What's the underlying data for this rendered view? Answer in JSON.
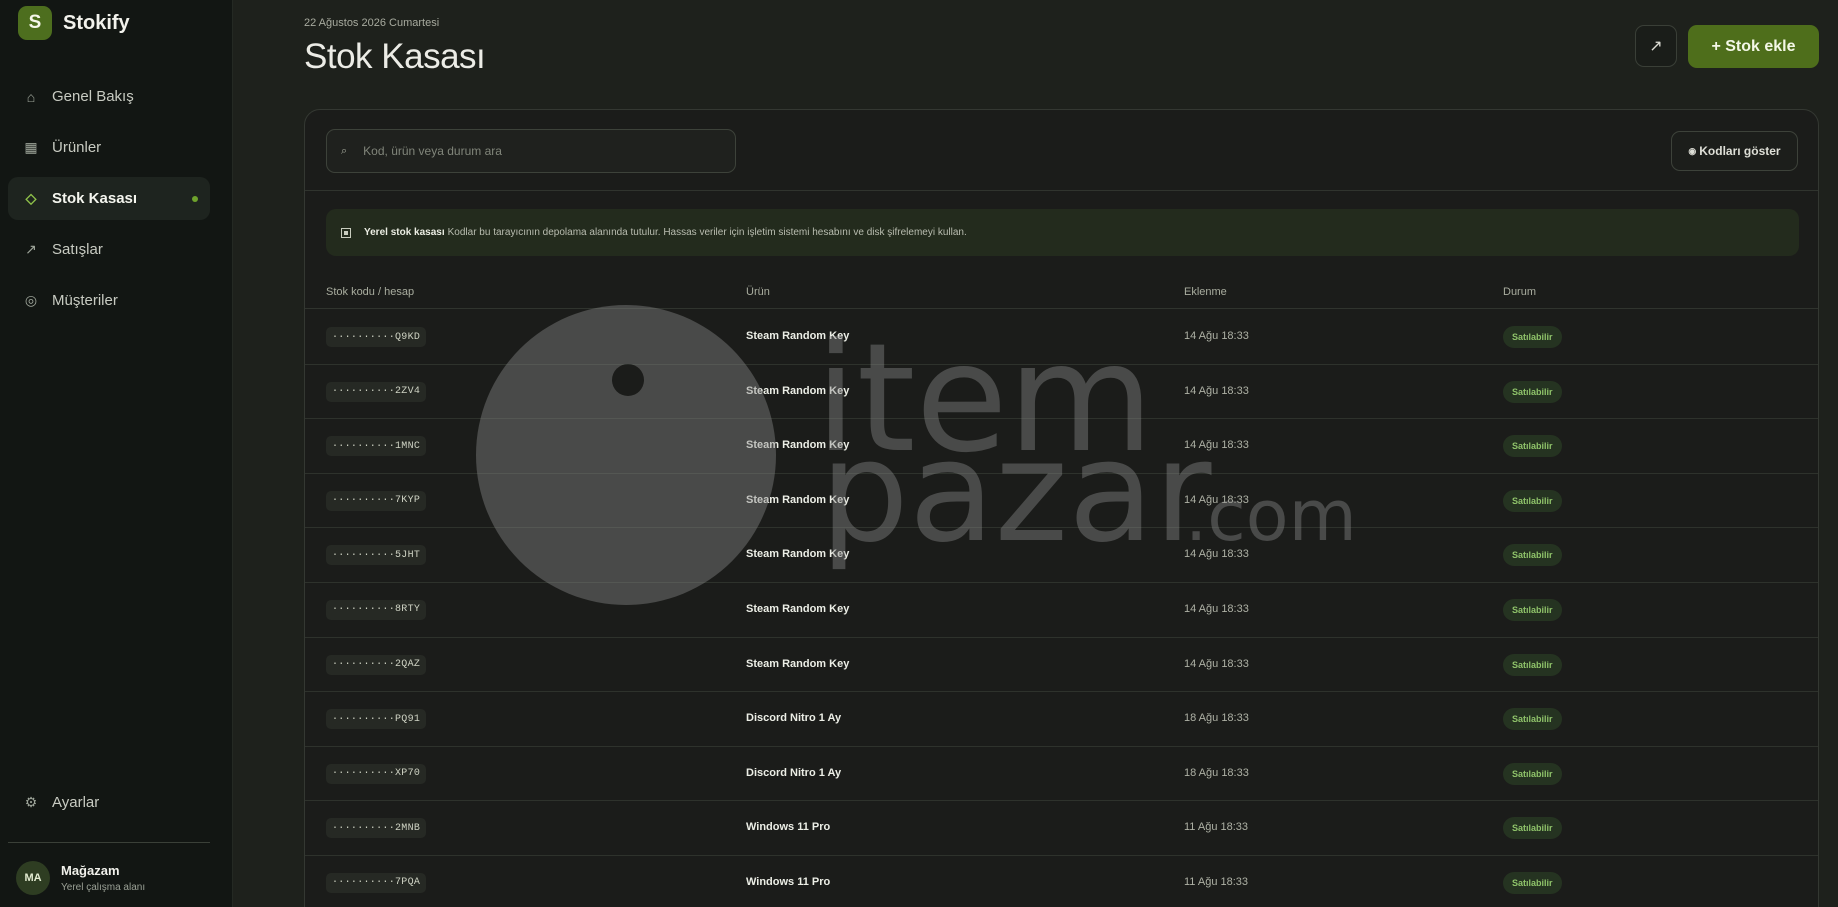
{
  "brand": {
    "logo_letter": "S",
    "name": "Stokify"
  },
  "nav": [
    {
      "label": "Genel Bakış",
      "icon": "home-icon",
      "glyph": "⌂",
      "active": false
    },
    {
      "label": "Ürünler",
      "icon": "grid-icon",
      "glyph": "▦",
      "active": false
    },
    {
      "label": "Stok Kasası",
      "icon": "diamond-icon",
      "glyph": "◇",
      "active": true
    },
    {
      "label": "Satışlar",
      "icon": "trend-arrow-icon",
      "glyph": "↗",
      "active": false
    },
    {
      "label": "Müşteriler",
      "icon": "target-icon",
      "glyph": "◎",
      "active": false
    }
  ],
  "settings": {
    "label": "Ayarlar",
    "glyph": "⚙"
  },
  "profile": {
    "initials": "MA",
    "name": "Mağazam",
    "subtitle": "Yerel çalışma alanı"
  },
  "header": {
    "date": "22 Ağustos 2026 Cumartesi",
    "title": "Stok Kasası",
    "export_glyph": "↗",
    "add_label": "+ Stok ekle"
  },
  "search": {
    "placeholder": "Kod, ürün veya durum ara",
    "icon_glyph": "⌕"
  },
  "show_codes": {
    "label": "Kodları göster",
    "icon_glyph": "◉"
  },
  "notice": {
    "title": "Yerel stok kasası",
    "text": "Kodlar bu tarayıcının depolama alanında tutulur. Hassas veriler için işletim sistemi hesabını ve disk şifrelemeyi kullan."
  },
  "table": {
    "columns": [
      "Stok kodu / hesap",
      "Ürün",
      "Eklenme",
      "Durum"
    ],
    "rows": [
      {
        "code": "··········Q9KD",
        "product": "Steam Random Key",
        "added": "14 Ağu 18:33",
        "status": "Satılabilir"
      },
      {
        "code": "··········2ZV4",
        "product": "Steam Random Key",
        "added": "14 Ağu 18:33",
        "status": "Satılabilir"
      },
      {
        "code": "··········1MNC",
        "product": "Steam Random Key",
        "added": "14 Ağu 18:33",
        "status": "Satılabilir"
      },
      {
        "code": "··········7KYP",
        "product": "Steam Random Key",
        "added": "14 Ağu 18:33",
        "status": "Satılabilir"
      },
      {
        "code": "··········5JHT",
        "product": "Steam Random Key",
        "added": "14 Ağu 18:33",
        "status": "Satılabilir"
      },
      {
        "code": "··········8RTY",
        "product": "Steam Random Key",
        "added": "14 Ağu 18:33",
        "status": "Satılabilir"
      },
      {
        "code": "··········2QAZ",
        "product": "Steam Random Key",
        "added": "14 Ağu 18:33",
        "status": "Satılabilir"
      },
      {
        "code": "··········PQ91",
        "product": "Discord Nitro 1 Ay",
        "added": "18 Ağu 18:33",
        "status": "Satılabilir"
      },
      {
        "code": "··········XP70",
        "product": "Discord Nitro 1 Ay",
        "added": "18 Ağu 18:33",
        "status": "Satılabilir"
      },
      {
        "code": "··········2MNB",
        "product": "Windows 11 Pro",
        "added": "11 Ağu 18:33",
        "status": "Satılabilir"
      },
      {
        "code": "··········7PQA",
        "product": "Windows 11 Pro",
        "added": "11 Ağu 18:33",
        "status": "Satılabilir"
      }
    ]
  },
  "watermark": {
    "line1": "item",
    "line2": "pazar",
    "suffix": ".com"
  }
}
